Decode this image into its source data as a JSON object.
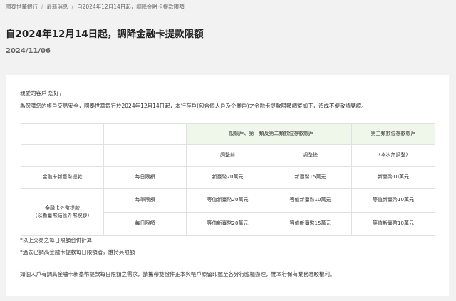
{
  "breadcrumb": {
    "items": [
      "國泰世華銀行",
      "最新消息",
      "自2024年12月14日起，調降金融卡提款限額"
    ],
    "separator": "/"
  },
  "header": {
    "title": "自2024年12月14日起，調降金融卡提款限額",
    "date": "2024/11/06"
  },
  "content": {
    "greeting": "親愛的客戶 您好，",
    "intro": "為保障您的帳戶交易安全，國泰世華銀行於2024年12月14日起，本行存戶(包含個人戶及企業戶)之金融卡提款限額調整如下，造成不便敬請見諒。",
    "table": {
      "group_header_1": "一般帳戶、第一類及第二類數位存款帳戶",
      "group_header_2": "第三類數位存款帳戶",
      "sub_before": "調整前",
      "sub_after": "調整後",
      "sub_unchanged": "(本次無調整)",
      "row1_label": "金融卡新臺幣提款",
      "row1_period": "每日限額",
      "row1_before": "新臺幣20萬元",
      "row1_after": "新臺幣15萬元",
      "row1_third": "新臺幣10萬元",
      "row2_label_line1": "金融卡外幣提款",
      "row2_label_line2": "(以新臺幣結匯外幣現鈔)",
      "row2_period": "每筆限額",
      "row2_before": "等值新臺幣20萬元",
      "row2_after": "等值新臺幣10萬元",
      "row2_third": "等值新臺幣10萬元",
      "row3_period": "每日限額",
      "row3_before": "等值新臺幣20萬元",
      "row3_after": "等值新臺幣15萬元",
      "row3_third": "等值新臺幣10萬元"
    },
    "note1": "*以上交易之每日限額合併計算",
    "note2": "*過去已調高金融卡提款每日限額者，維持其限額",
    "closing": "如個人戶有調高金融卡新臺幣提款每日限額之需求，請攜帶雙證件正本與帳戶原留印鑑至各分行臨櫃辦理，惟本行保有業務准駁權利。"
  },
  "colors": {
    "page_bg": "#f2f2f2",
    "card_bg": "#ffffff",
    "header_highlight": "#eef7ea"
  }
}
